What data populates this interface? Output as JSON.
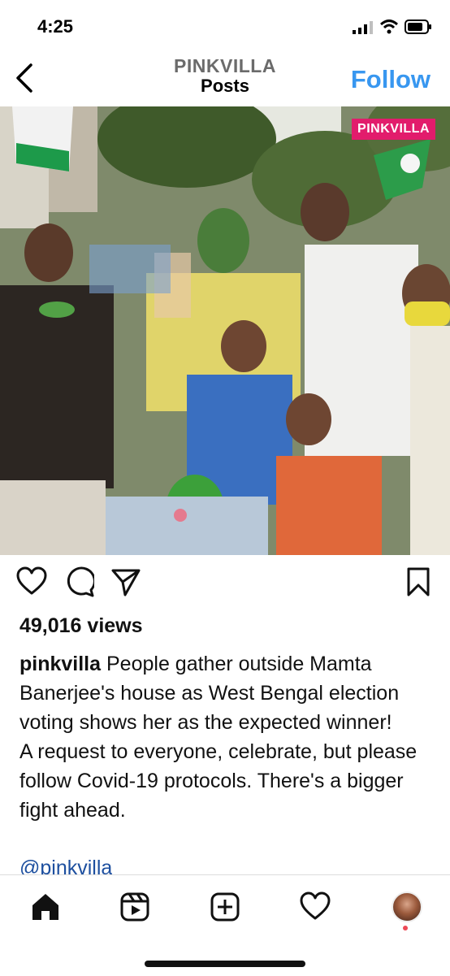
{
  "status_bar": {
    "time": "4:25"
  },
  "header": {
    "account": "PINKVILLA",
    "title": "Posts",
    "follow_label": "Follow"
  },
  "media": {
    "watermark": "PINKVILLA",
    "description_icons": [
      "crowd",
      "flags"
    ]
  },
  "actions": {
    "like_icon": "heart-icon",
    "comment_icon": "comment-icon",
    "share_icon": "send-icon",
    "save_icon": "bookmark-icon"
  },
  "post": {
    "views": "49,016 views",
    "username": "pinkvilla",
    "caption_line1": "People gather outside Mamta Banerjee's house as West Bengal election voting shows her as the expected winner!",
    "caption_line2": "A request to everyone, celebrate, but please follow Covid-19 protocols. There's a bigger fight ahead.",
    "mention": "@pinkvilla"
  },
  "bottom_nav": {
    "items": [
      "home-icon",
      "reels-icon",
      "new-post-icon",
      "activity-icon",
      "profile-avatar"
    ]
  },
  "colors": {
    "accent": "#3897f0",
    "watermark_bg": "#e21c6c",
    "mention": "#1d4f9f"
  }
}
